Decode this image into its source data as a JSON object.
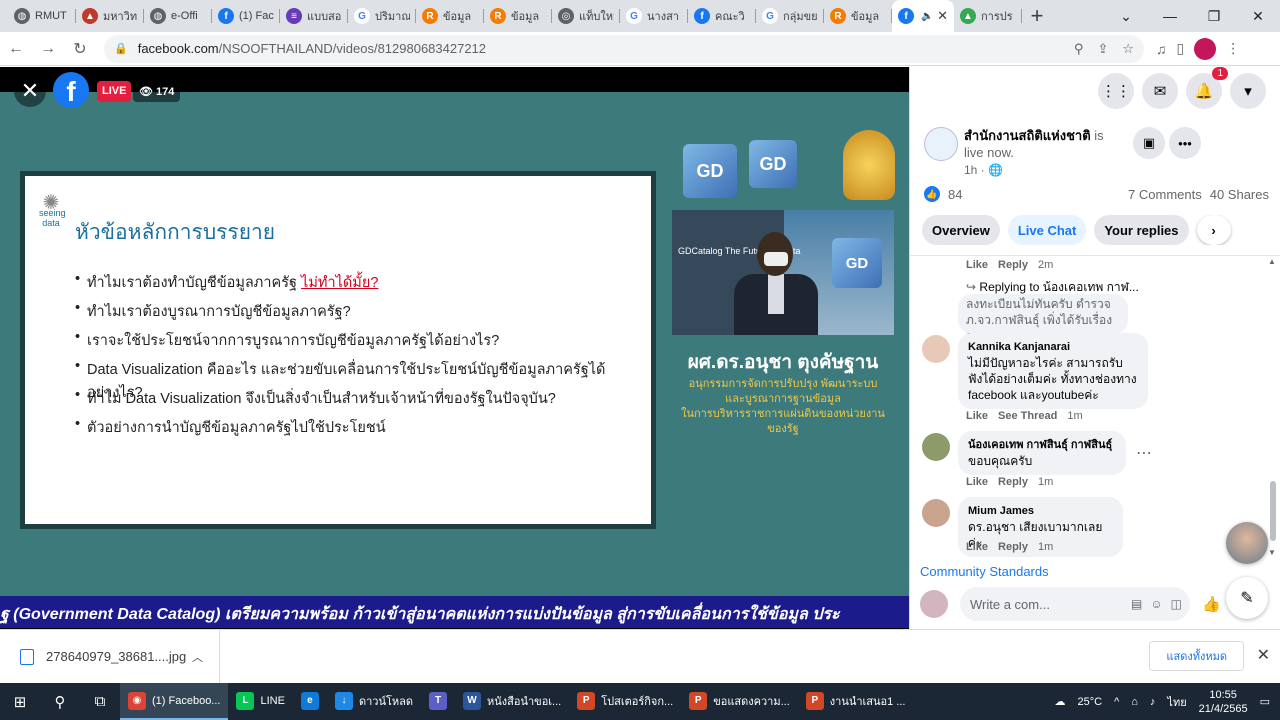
{
  "browser": {
    "tabs": [
      {
        "label": "RMUT",
        "icon": "globe-icon",
        "color": "#5f6368",
        "glyph": "◍"
      },
      {
        "label": "มหาวิท",
        "icon": "university-icon",
        "color": "#c0392b",
        "glyph": "▲"
      },
      {
        "label": "e-Offi",
        "icon": "globe-icon",
        "color": "#5f6368",
        "glyph": "◍"
      },
      {
        "label": "(1) Fac",
        "icon": "facebook-icon",
        "color": "#1877f2",
        "glyph": "f"
      },
      {
        "label": "แบบสอ",
        "icon": "forms-icon",
        "color": "#673ab7",
        "glyph": "≡"
      },
      {
        "label": "ปริมาณ",
        "icon": "google-icon",
        "color": "#ffffff",
        "glyph": "G"
      },
      {
        "label": "ข้อมูล",
        "icon": "orange-site-icon",
        "color": "#f57c00",
        "glyph": "R"
      },
      {
        "label": "ข้อมูล",
        "icon": "orange-site-icon",
        "color": "#f57c00",
        "glyph": "R"
      },
      {
        "label": "แท็บใหม่",
        "icon": "chrome-icon",
        "color": "#5f6368",
        "glyph": "◎"
      },
      {
        "label": "นางสา",
        "icon": "google-icon",
        "color": "#ffffff",
        "glyph": "G"
      },
      {
        "label": "คณะวิ",
        "icon": "facebook-square-icon",
        "color": "#1877f2",
        "glyph": "f"
      },
      {
        "label": "กลุ่มขย",
        "icon": "google-icon",
        "color": "#ffffff",
        "glyph": "G"
      },
      {
        "label": "ข้อมูล",
        "icon": "orange-site-icon",
        "color": "#f57c00",
        "glyph": "R"
      },
      {
        "label": "",
        "icon": "facebook-icon",
        "color": "#1877f2",
        "glyph": "f",
        "active": true
      },
      {
        "label": "การปร",
        "icon": "drive-icon",
        "color": "#34a853",
        "glyph": "▲"
      }
    ],
    "new_tab": "+",
    "url_host": "facebook.com",
    "url_path": "/NSOOFTHAILAND/videos/812980683427212"
  },
  "video": {
    "live_label": "LIVE",
    "viewers": "174",
    "slide_title": "หัวข้อหลักการบรรยาย",
    "seeing_label": "seeing data",
    "bullets": [
      {
        "text": "ทำไมเราต้องทำบัญชีข้อมูลภาครัฐ ",
        "highlight": "ไม่ทำได้มั้ย?"
      },
      {
        "text": "ทำไมเราต้องบูรณาการบัญชีข้อมูลภาครัฐ?",
        "highlight": ""
      },
      {
        "text": "เราจะใช้ประโยชน์จากการบูรณาการบัญชีข้อมูลภาครัฐได้อย่างไร?",
        "highlight": ""
      },
      {
        "text": "Data Visualization คืออะไร และช่วยขับเคลื่อนการใช้ประโยชน์บัญชีข้อมูลภาครัฐได้อย่างไร?",
        "highlight": ""
      },
      {
        "text": "ทำไม Data Visualization จึงเป็นสิ่งจำเป็นสำหรับเจ้าหน้าที่ของรัฐในปัจจุบัน?",
        "highlight": ""
      },
      {
        "text": "ตัวอย่างการนำบัญชีข้อมูลภาครัฐไปใช้ประโยชน์",
        "highlight": ""
      }
    ],
    "logo_letters": [
      "GD",
      "GD",
      "GD"
    ],
    "speaker_box_label": "GDCatalog The Future of Data",
    "speaker_name": "ผศ.ดร.อนุชา ตุงคัษฐาน",
    "speaker_title_lines": [
      "อนุกรรมการจัดการปรับปรุง พัฒนาระบบ",
      "และบูรณาการฐานข้อมูล",
      "ในการบริหารราชการแผ่นดินของหน่วยงานของรัฐ"
    ],
    "ticker": "ฐ (Government Data Catalog) เตรียมความพร้อม ก้าวเข้าสู่อนาคตแห่งการแบ่งปันข้อมูล สู่การขับเคลื่อนการใช้ข้อมูล ประ"
  },
  "panel": {
    "notification_count": "1",
    "page_name": "สำนักงานสถิติแห่งชาติ",
    "page_status": " is live now.",
    "post_time": "1h · 🌐",
    "likes": "84",
    "comments_count": "7 Comments",
    "shares": "40 Shares",
    "tabs": [
      "Overview",
      "Live Chat",
      "Your replies"
    ],
    "comments": [
      {
        "like": "Like",
        "reply": "Reply",
        "time": "2m"
      },
      {
        "replying_to": "Replying to น้องเคอเทพ กาฬ...",
        "text_lines": [
          "ลงทะเบียนไม่ทันครับ ตำรวจ",
          "ภ.จว.กาฬสินธุ์ เพิ่งได้รับเรื่องว..."
        ]
      },
      {
        "name": "Kannika Kanjanarai",
        "text_lines": [
          "ไม่มีปัญหาอะไรค่ะ สามารถรับ",
          "ฟังได้อย่างเต็มค่ะ ทั้งทางช่องทาง",
          "facebook และyoutubeค่ะ"
        ],
        "like": "Like",
        "reply": "See Thread",
        "time": "1m"
      },
      {
        "name": "น้องเคอเทพ กาฬสินธุ์ กาฬสินธุ์",
        "text_lines": [
          "ขอบคุณครับ"
        ],
        "like": "Like",
        "reply": "Reply",
        "time": "1m"
      },
      {
        "name": "Mium James",
        "text_lines": [
          "ดร.อนุชา เสียงเบามากเลยค่ะ"
        ],
        "like": "Like",
        "reply": "Reply",
        "time": "1m"
      }
    ],
    "community_standards": "Community Standards",
    "write_placeholder": "Write a com..."
  },
  "downloads": {
    "file": "278640979_38681....jpg",
    "show_all": "แสดงทั้งหมด"
  },
  "taskbar": {
    "apps": [
      {
        "label": "(1) Faceboo...",
        "icon": "chrome-icon",
        "color": "#db4437",
        "glyph": "◉",
        "active": true
      },
      {
        "label": "LINE",
        "icon": "line-icon",
        "color": "#06c755",
        "glyph": "L"
      },
      {
        "label": "",
        "icon": "edge-icon",
        "color": "#0f7ad8",
        "glyph": "e"
      },
      {
        "label": "ดาวน์โหลด",
        "icon": "download-icon",
        "color": "#1e88e5",
        "glyph": "↓"
      },
      {
        "label": "",
        "icon": "teams-icon",
        "color": "#5b5fc7",
        "glyph": "T"
      },
      {
        "label": "หนังสือนำขอเ...",
        "icon": "word-icon",
        "color": "#2b579a",
        "glyph": "W"
      },
      {
        "label": "โปสเตอร์กิจก...",
        "icon": "powerpoint-icon",
        "color": "#d24726",
        "glyph": "P"
      },
      {
        "label": "ขอแสดงความ...",
        "icon": "powerpoint-icon",
        "color": "#d24726",
        "glyph": "P"
      },
      {
        "label": "งานนำเสนอ1 ...",
        "icon": "powerpoint-icon",
        "color": "#d24726",
        "glyph": "P"
      }
    ],
    "temperature": "25°C",
    "language": "ไทย",
    "time": "10:55",
    "date": "21/4/2565"
  }
}
